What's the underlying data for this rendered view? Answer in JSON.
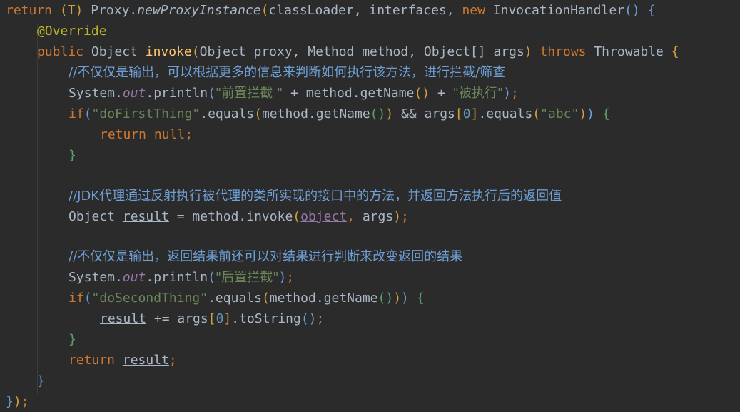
{
  "editor": {
    "lines": [
      "return (T) Proxy.newProxyInstance(classLoader, interfaces, new InvocationHandler() {",
      "@Override",
      "public Object invoke(Object proxy, Method method, Object[] args) throws Throwable {",
      "//不仅仅是输出，可以根据更多的信息来判断如何执行该方法，进行拦截/筛查",
      "System.out.println(\"前置拦截 \" + method.getName() + \"被执行\");",
      "if(\"doFirstThing\".equals(method.getName()) && args[0].equals(\"abc\")) {",
      "return null;",
      "}",
      "",
      "//JDK代理通过反射执行被代理的类所实现的接口中的方法，并返回方法执行后的返回值",
      "Object result = method.invoke(object, args);",
      "",
      "//不仅仅是输出，返回结果前还可以对结果进行判断来改变返回的结果",
      "System.out.println(\"后置拦截\");",
      "if(\"doSecondThing\".equals(method.getName())) {",
      "result += args[0].toString();",
      "}",
      "return result;",
      "}",
      "});"
    ]
  },
  "tokens": {
    "l1": {
      "return": "return",
      "cast": "(T)",
      "proxy": "Proxy.",
      "npi": "newProxyInstance",
      "open": "(",
      "args": "classLoader, interfaces, ",
      "new": "new",
      "ih": "InvocationHandler",
      "paren": "()",
      "brace": "{"
    },
    "l2": {
      "override": "@Override"
    },
    "l3": {
      "public": "public",
      "object": "Object",
      "invoke": "invoke",
      "open": "(",
      "params": "Object proxy, Method method, Object[] args",
      "close": ")",
      "throws": "throws",
      "throwable": "Throwable",
      "brace": "{"
    },
    "l4": {
      "comment": "//不仅仅是输出，可以根据更多的信息来判断如何执行该方法，进行拦截/筛查"
    },
    "l5": {
      "system": "System.",
      "out": "out",
      "println": ".println",
      "open": "(",
      "s1": "\"前置拦截 \"",
      "plus1": " + method.getName",
      "p1": "()",
      "plus2": " + ",
      "s2": "\"被执行\"",
      "close": ")",
      "semi": ";"
    },
    "l6": {
      "if": "if",
      "open": "(",
      "s1": "\"doFirstThing\"",
      "eq1": ".equals",
      "open2": "(",
      "getname": "method.getName",
      "p": "()",
      "close2": ")",
      "and": " && args",
      "br1": "[",
      "zero": "0",
      "br2": "]",
      "eq2": ".equals",
      "open3": "(",
      "s2": "\"abc\"",
      "close3": ")",
      "close": ")",
      "brace": "{"
    },
    "l7": {
      "return": "return",
      "null": "null",
      "semi": ";"
    },
    "l8": {
      "brace": "}"
    },
    "l10": {
      "comment": "//JDK代理通过反射执行被代理的类所实现的接口中的方法，并返回方法执行后的返回值"
    },
    "l11": {
      "object": "Object ",
      "result": "result",
      "assign": " = method.invoke",
      "open": "(",
      "obj": "object",
      "comma": ",",
      "args": " args",
      "close": ")",
      "semi": ";"
    },
    "l13": {
      "comment": "//不仅仅是输出，返回结果前还可以对结果进行判断来改变返回的结果"
    },
    "l14": {
      "system": "System.",
      "out": "out",
      "println": ".println",
      "open": "(",
      "s1": "\"后置拦截\"",
      "close": ")",
      "semi": ";"
    },
    "l15": {
      "if": "if",
      "open": "(",
      "s1": "\"doSecondThing\"",
      "eq": ".equals",
      "open2": "(",
      "getname": "method.getName",
      "p": "()",
      "close2": ")",
      "close": ")",
      "brace": "{"
    },
    "l16": {
      "result": "result",
      "plus": " += args",
      "br1": "[",
      "zero": "0",
      "br2": "]",
      "tostr": ".toString",
      "p": "()",
      "semi": ";"
    },
    "l17": {
      "brace": "}"
    },
    "l18": {
      "return": "return",
      "result": "result",
      "semi": ";"
    },
    "l19": {
      "brace": "}"
    },
    "l20": {
      "close": "}",
      "paren": ")",
      "semi": ";"
    }
  },
  "colors": {
    "background": "#2b2b2b",
    "text": "#a9b7c6",
    "keyword": "#cc7832",
    "annotation": "#bbb529",
    "string": "#6a8759",
    "number": "#6897bb",
    "comment": "#629755",
    "method_declaration": "#ffc66d",
    "static_field": "#9876aa"
  }
}
